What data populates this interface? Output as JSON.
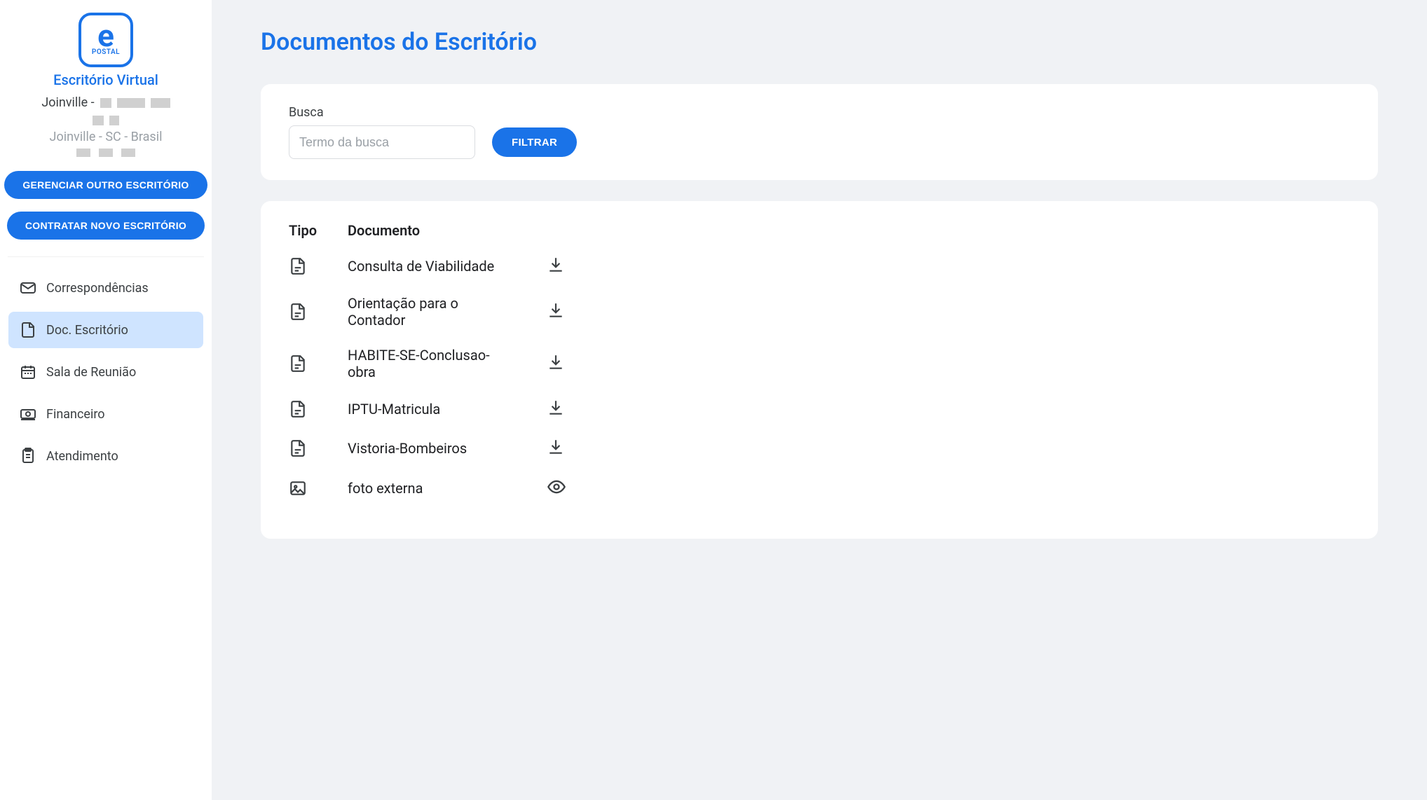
{
  "app": {
    "logo_letter": "e",
    "logo_sub": "POSTAL",
    "title": "Escritório Virtual",
    "location_prefix": "Joinville -",
    "location_full": "Joinville - SC - Brasil"
  },
  "sidebar_buttons": {
    "manage": "GERENCIAR OUTRO ESCRITÓRIO",
    "hire": "CONTRATAR NOVO ESCRITÓRIO"
  },
  "nav": {
    "items": [
      {
        "label": "Correspondências",
        "icon": "mail",
        "active": false
      },
      {
        "label": "Doc. Escritório",
        "icon": "document",
        "active": true
      },
      {
        "label": "Sala de Reunião",
        "icon": "calendar",
        "active": false
      },
      {
        "label": "Financeiro",
        "icon": "money",
        "active": false
      },
      {
        "label": "Atendimento",
        "icon": "clipboard",
        "active": false
      }
    ]
  },
  "page": {
    "title": "Documentos do Escritório"
  },
  "search": {
    "label": "Busca",
    "placeholder": "Termo da busca",
    "filter_button": "FILTRAR"
  },
  "table": {
    "headers": {
      "type": "Tipo",
      "document": "Documento"
    },
    "rows": [
      {
        "type": "document",
        "name": "Consulta de Viabilidade",
        "action": "download"
      },
      {
        "type": "document",
        "name": "Orientação para o Contador",
        "action": "download"
      },
      {
        "type": "document",
        "name": "HABITE-SE-Conclusao-obra",
        "action": "download"
      },
      {
        "type": "document",
        "name": "IPTU-Matricula",
        "action": "download"
      },
      {
        "type": "document",
        "name": "Vistoria-Bombeiros",
        "action": "download"
      },
      {
        "type": "image",
        "name": "foto externa",
        "action": "view"
      }
    ]
  }
}
